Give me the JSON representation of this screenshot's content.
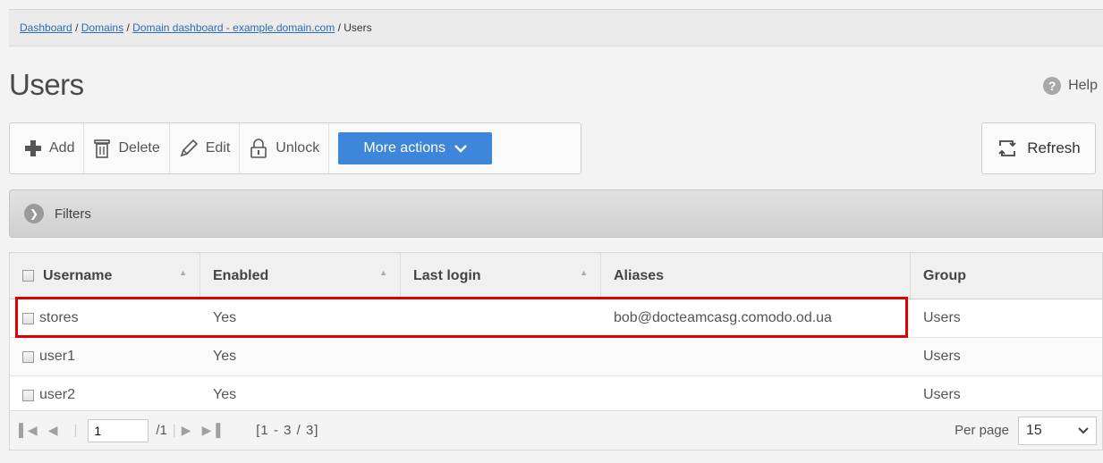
{
  "breadcrumb": [
    {
      "label": "Dashboard"
    },
    {
      "label": "Domains"
    },
    {
      "label": "Domain dashboard - example.domain.com"
    },
    {
      "label": "Users"
    }
  ],
  "page_title": "Users",
  "help_label": "Help",
  "toolbar": {
    "add": "Add",
    "delete": "Delete",
    "edit": "Edit",
    "unlock": "Unlock",
    "more_actions": "More actions",
    "refresh": "Refresh"
  },
  "filters_label": "Filters",
  "table": {
    "columns": [
      "Username",
      "Enabled",
      "Last login",
      "Aliases",
      "Group"
    ],
    "rows": [
      {
        "username": "stores",
        "enabled": "Yes",
        "last_login": "",
        "aliases": "bob@docteamcasg.comodo.od.ua",
        "group": "Users"
      },
      {
        "username": "user1",
        "enabled": "Yes",
        "last_login": "",
        "aliases": "",
        "group": "Users"
      },
      {
        "username": "user2",
        "enabled": "Yes",
        "last_login": "",
        "aliases": "",
        "group": "Users"
      }
    ]
  },
  "pager": {
    "page": "1",
    "total_pages": "/1",
    "range": "[1 - 3 / 3]",
    "per_page_label": "Per page",
    "per_page_value": "15"
  },
  "colors": {
    "accent": "#3d86d9",
    "highlight": "#e00000",
    "link": "#2a6bb5"
  }
}
